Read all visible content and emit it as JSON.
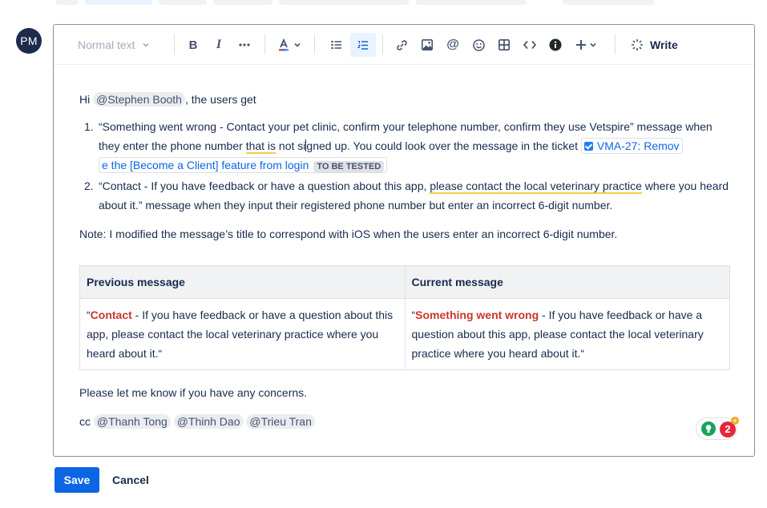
{
  "avatar": {
    "initials": "PM"
  },
  "toolbar": {
    "text_style": "Normal text",
    "write_label": "Write",
    "icons": [
      "bold-icon",
      "italic-icon",
      "more-formatting-icon",
      "text-color-icon",
      "bullet-list-icon",
      "numbered-list-icon",
      "link-icon",
      "image-icon",
      "mention-icon",
      "emoji-icon",
      "table-icon",
      "code-icon",
      "info-icon",
      "insert-plus-icon",
      "ai-write-icon"
    ]
  },
  "content": {
    "greeting_pre": "Hi ",
    "greeting_mention": "@Stephen Booth",
    "greeting_post": ", the users get",
    "item1_num": "1.",
    "item1_a": "“Something went wrong - Contact your pet clinic, confirm your telephone number, confirm they use Vetspire” message when they enter the phone number ",
    "item1_underlined": "that is",
    "item1_b": " not si",
    "item1_c": "gned up. You could look over the message in the ticket ",
    "ticket_line1": "VMA-27: Remov",
    "ticket_line2": "e the [Become a Client] feature from login",
    "ticket_status": "TO BE TESTED",
    "item2_num": "2.",
    "item2_a": "“Contact - If you have feedback or have a question about this app, ",
    "item2_underlined": "please contact the local veterinary practice",
    "item2_b": " where you heard about it.” message when they input their registered phone number but enter an incorrect 6-digit number.",
    "note": "Note: I modified the message’s title to correspond with iOS when the users enter an incorrect 6-digit number."
  },
  "table": {
    "headers": [
      "Previous message",
      "Current message"
    ],
    "prev_open": "“",
    "prev_bold": "Contact",
    "prev_rest": " - If you have feedback or have a question about this app, please contact the local veterinary practice where you heard about it.“",
    "curr_open": "“",
    "curr_bold": "Something went wrong",
    "curr_rest": " - If you have feedback or have a question about this app, please contact the local veterinary practice where you heard about it.“"
  },
  "closing": "Please let me know if you have any concerns.",
  "cc": {
    "label": "cc ",
    "mentions": [
      "@Thanh Tong",
      "@Thinh Dao",
      "@Trieu Tran"
    ]
  },
  "grammar": {
    "count": "2",
    "plus": "+"
  },
  "actions": {
    "save": "Save",
    "cancel": "Cancel"
  },
  "colors": {
    "primary": "#0c66e4",
    "accent_red": "#c9372c",
    "avatar_bg": "#1d2b4d"
  }
}
